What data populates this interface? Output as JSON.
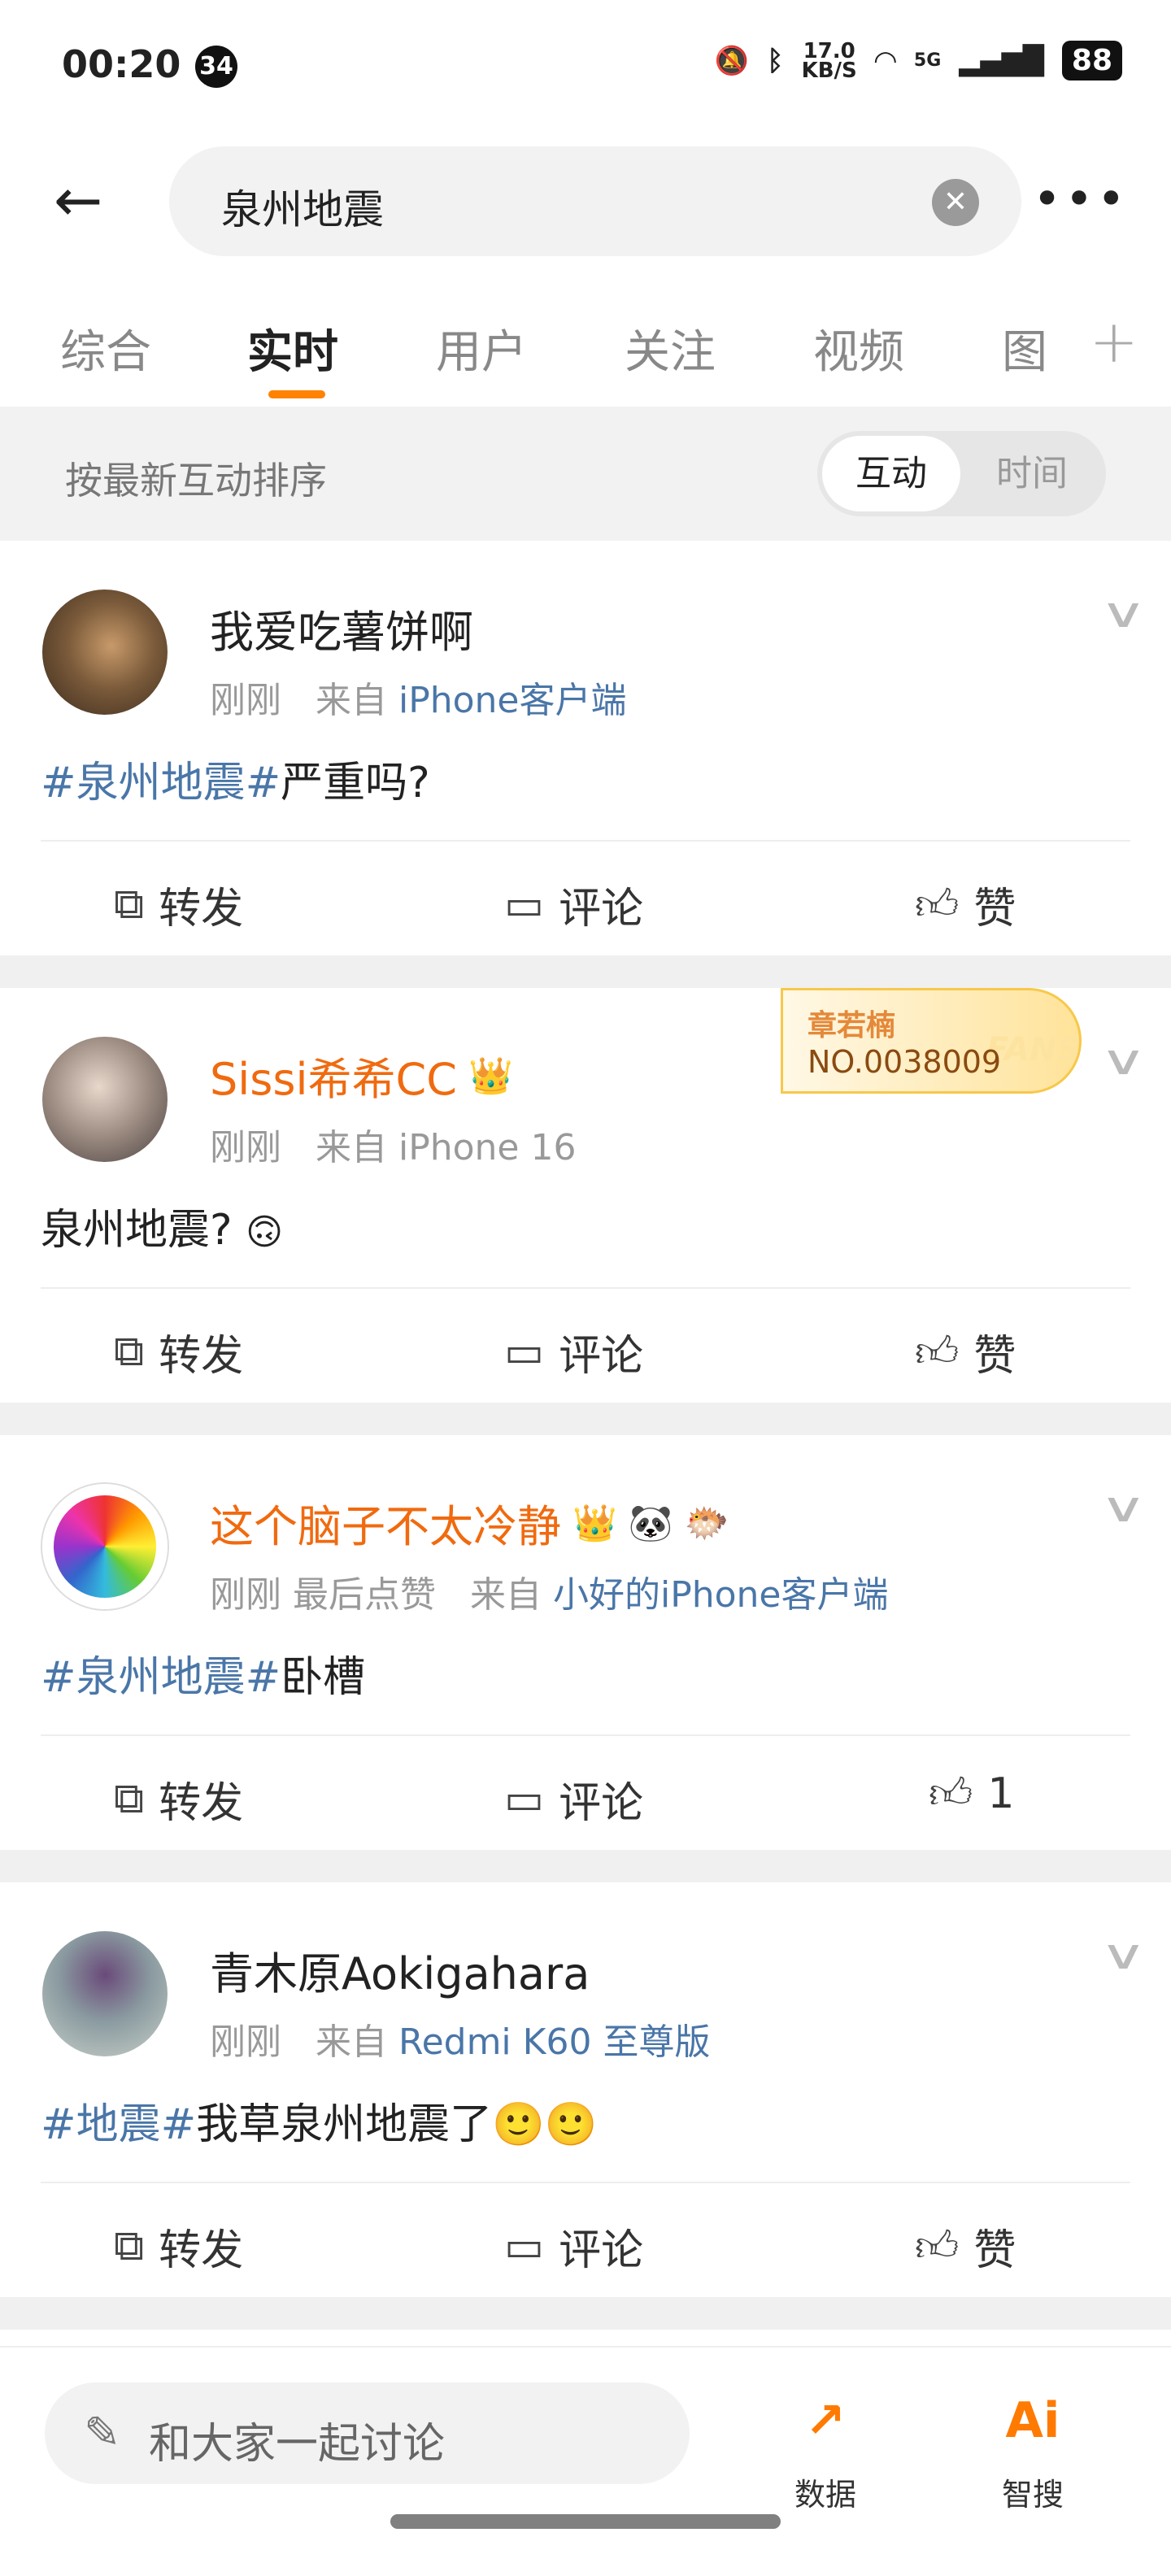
{
  "status_bar": {
    "time": "00:20",
    "notification_count": "34",
    "net_speed_value": "17.0",
    "net_speed_unit": "KB/S",
    "network": "5G",
    "battery": "88"
  },
  "search": {
    "query": "泉州地震"
  },
  "tabs": [
    {
      "label": "综合"
    },
    {
      "label": "实时",
      "active": true
    },
    {
      "label": "用户"
    },
    {
      "label": "关注"
    },
    {
      "label": "视频"
    },
    {
      "label": "图"
    }
  ],
  "sort": {
    "label": "按最新互动排序",
    "options": [
      "互动",
      "时间"
    ],
    "selected": "互动"
  },
  "actions": {
    "repost": "转发",
    "comment": "评论",
    "like": "赞"
  },
  "posts": [
    {
      "name": "我爱吃薯饼啊",
      "time": "刚刚",
      "from_label": "来自",
      "source": "iPhone客户端",
      "tag": "#泉州地震#",
      "text": "严重吗?",
      "like": "赞"
    },
    {
      "name": "Sissi希希CC",
      "time": "刚刚",
      "from_label": "来自",
      "source": "iPhone 16",
      "tag": "",
      "text": "泉州地震?",
      "like": "赞",
      "fan_badge": {
        "name": "章若楠",
        "number": "NO.0038009",
        "word": "FANS"
      }
    },
    {
      "name": "这个脑子不太冷静",
      "time": "刚刚",
      "extra": "最后点赞",
      "from_label": "来自",
      "source": "小好的iPhone客户端",
      "tag": "#泉州地震#",
      "text": "卧槽",
      "like": "1"
    },
    {
      "name": "青木原Aokigahara",
      "time": "刚刚",
      "from_label": "来自",
      "source": "Redmi K60 至尊版",
      "tag": "#地震#",
      "text": "我草泉州地震了🙂🙂",
      "like": "赞"
    }
  ],
  "bottom": {
    "placeholder": "和大家一起讨论",
    "data_label": "数据",
    "ai_label": "智搜",
    "ai_icon_text": "Ai"
  },
  "colors": {
    "accent": "#ff8200",
    "link": "#4a76a8",
    "vip_name": "#f06a0f"
  }
}
